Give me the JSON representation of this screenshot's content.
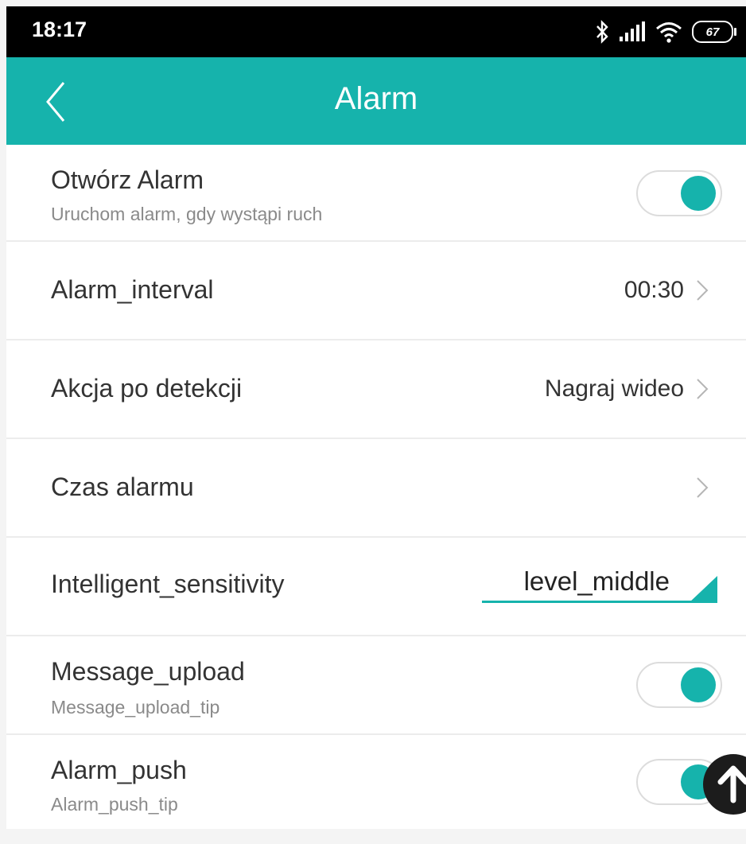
{
  "status_bar": {
    "time": "18:17",
    "battery": "67",
    "icons": [
      "bluetooth-icon",
      "signal-icon",
      "wifi-icon",
      "battery-icon"
    ]
  },
  "app_bar": {
    "title": "Alarm",
    "back_icon": "back-chevron-icon"
  },
  "settings": {
    "open_alarm": {
      "title": "Otwórz Alarm",
      "subtitle": "Uruchom alarm, gdy wystąpi ruch",
      "enabled": true
    },
    "alarm_interval": {
      "title": "Alarm_interval",
      "value": "00:30"
    },
    "detection_action": {
      "title": "Akcja po detekcji",
      "value": "Nagraj wideo"
    },
    "alarm_time": {
      "title": "Czas alarmu"
    },
    "sensitivity": {
      "title": "Intelligent_sensitivity",
      "selected": "level_middle"
    },
    "message_upload": {
      "title": "Message_upload",
      "subtitle": "Message_upload_tip",
      "enabled": true
    },
    "alarm_push": {
      "title": "Alarm_push",
      "subtitle": "Alarm_push_tip",
      "enabled": true
    }
  },
  "fab": {
    "icon": "arrow-up-icon"
  },
  "colors": {
    "accent": "#16b3ac",
    "status_bar": "#000000",
    "background": "#f4f4f4",
    "text": "#333333",
    "subtext": "#8a8a8a"
  }
}
